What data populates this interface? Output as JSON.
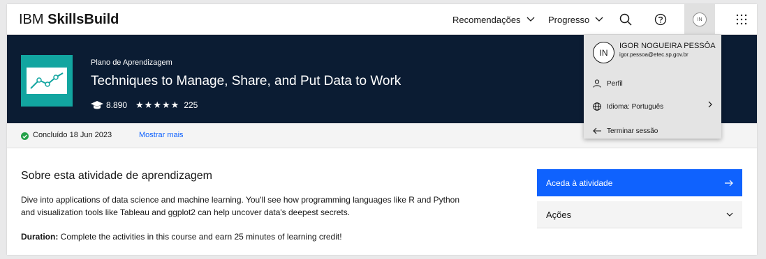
{
  "header": {
    "brand_regular": "IBM ",
    "brand_bold": "SkillsBuild",
    "nav": [
      {
        "label": "Recomendações"
      },
      {
        "label": "Progresso"
      }
    ],
    "avatar_initials": "IN"
  },
  "hero": {
    "plan_label": "Plano de Aprendizagem",
    "title": "Techniques to Manage, Share, and Put Data to Work",
    "learners": "8.890",
    "stars": "★★★★★",
    "rating_count": "225"
  },
  "completion": {
    "text": "Concluído 18 Jun 2023",
    "show_more": "Mostrar mais"
  },
  "about": {
    "title": "Sobre esta atividade de aprendizagem",
    "description": "Dive into applications of data science and machine learning. You'll see how programming languages like R and Python and visualization tools like Tableau and ggplot2 can help uncover data's deepest secrets.",
    "duration_label": "Duration:",
    "duration_text": " Complete the activities in this course and earn 25 minutes of learning credit!"
  },
  "sidebar": {
    "cta_label": "Aceda à atividade",
    "actions_label": "Ações"
  },
  "profile_menu": {
    "initials": "IN",
    "name": "IGOR NOGUEIRA PESSÔA",
    "email": "igor.pessoa@etec.sp.gov.br",
    "items": [
      {
        "label": "Perfil"
      },
      {
        "label": "Idioma: Português"
      },
      {
        "label": "Terminar sessão"
      }
    ]
  },
  "colors": {
    "hero_bg": "#0b1c33",
    "accent_blue": "#0f62fe",
    "thumb_teal": "#12a5a0",
    "success_green": "#24a148"
  }
}
